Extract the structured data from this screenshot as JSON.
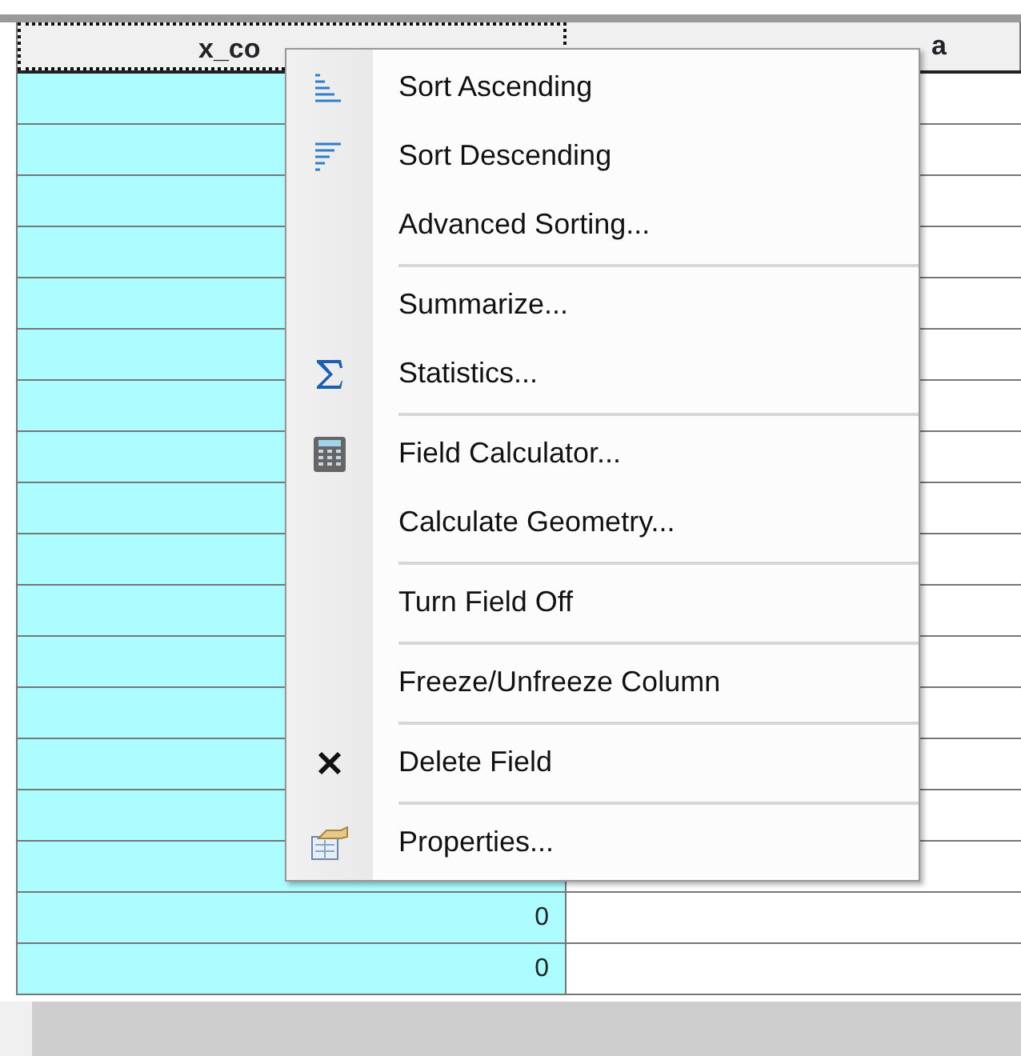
{
  "table": {
    "columns": [
      {
        "label": "x_co",
        "focused": true
      },
      {
        "label": "a",
        "focused": false
      }
    ],
    "rows": [
      {},
      {},
      {},
      {},
      {},
      {},
      {},
      {},
      {},
      {},
      {},
      {},
      {},
      {},
      {},
      {},
      {
        "column_1": "0"
      },
      {
        "column_1": "0"
      }
    ]
  },
  "context_menu": {
    "items": [
      {
        "kind": "ascending",
        "label": "Sort Ascending"
      },
      {
        "kind": "descending",
        "label": "Sort Descending"
      },
      {
        "kind": "plain",
        "label": "Advanced Sorting..."
      },
      {
        "kind": "separator"
      },
      {
        "kind": "plain",
        "label": "Summarize..."
      },
      {
        "kind": "sum",
        "label": "Statistics..."
      },
      {
        "kind": "separator"
      },
      {
        "kind": "calculator",
        "label": "Field Calculator..."
      },
      {
        "kind": "plain",
        "label": "Calculate Geometry..."
      },
      {
        "kind": "separator"
      },
      {
        "kind": "plain",
        "label": "Turn Field Off"
      },
      {
        "kind": "separator"
      },
      {
        "kind": "plain",
        "label": "Freeze/Unfreeze Column"
      },
      {
        "kind": "separator"
      },
      {
        "kind": "delete",
        "label": "Delete Field"
      },
      {
        "kind": "separator"
      },
      {
        "kind": "properties",
        "label": "Properties..."
      }
    ]
  }
}
